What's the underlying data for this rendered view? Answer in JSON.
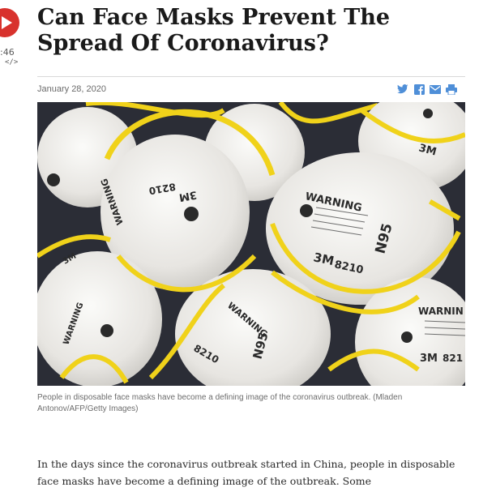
{
  "player": {
    "time": ":46",
    "embed_label": "</>"
  },
  "article": {
    "title": "Can Face Masks Prevent The Spread Of Coronavirus?",
    "date": "January 28, 2020",
    "caption": "People in disposable face masks have become a defining image of the coronavirus outbreak. (Mladen Antonov/AFP/Getty Images)",
    "body": "In the days since the coronavirus outbreak started in China, people in disposable face masks have become a defining image of the outbreak. Some"
  },
  "share_icons": [
    "twitter-icon",
    "facebook-icon",
    "email-icon",
    "print-icon"
  ],
  "photo_marks": {
    "warning": "WARNING",
    "brand": "3M",
    "model": "8210",
    "rating": "N95",
    "warning_cut": "WARNIN",
    "model_cut": "821"
  },
  "colors": {
    "play": "#d8322d",
    "share": "#4f8fd8",
    "strap": "#f0d21a",
    "mask": "#eceae6"
  }
}
